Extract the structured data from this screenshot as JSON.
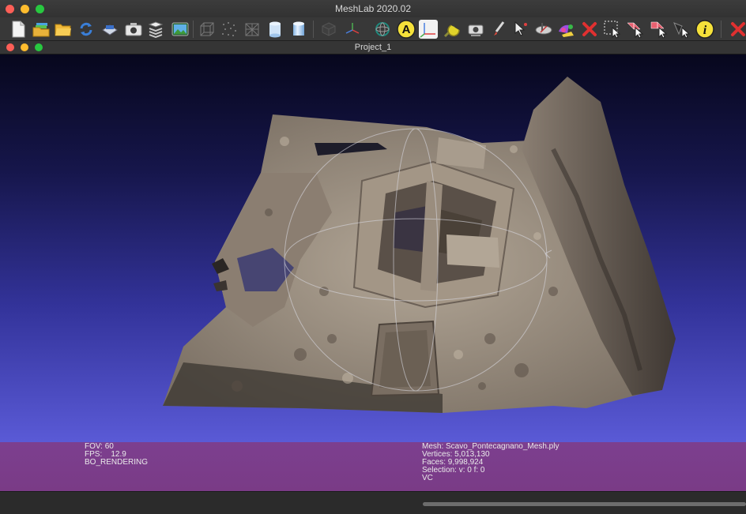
{
  "window": {
    "title": "MeshLab 2020.02"
  },
  "document": {
    "title": "Project_1"
  },
  "toolbar": {
    "buttons": [
      {
        "name": "new-project",
        "icon": "new-document-icon"
      },
      {
        "name": "open-project",
        "icon": "layers-folder-icon"
      },
      {
        "name": "import-mesh",
        "icon": "open-folder-icon"
      },
      {
        "name": "reload",
        "icon": "reload-icon"
      },
      {
        "name": "export-mesh",
        "icon": "save-mesh-icon"
      },
      {
        "name": "snapshot",
        "icon": "camera-icon"
      },
      {
        "name": "layer-dialog",
        "icon": "layers-stack-icon"
      },
      {
        "name": "raster-view",
        "icon": "raster-image-icon"
      },
      {
        "name": "bounding-box",
        "icon": "bbox-icon"
      },
      {
        "name": "points",
        "icon": "points-icon"
      },
      {
        "name": "wireframe",
        "icon": "wireframe-icon"
      },
      {
        "name": "flat",
        "icon": "flat-cylinder-icon"
      },
      {
        "name": "smooth",
        "icon": "smooth-cylinder-icon"
      },
      {
        "name": "texture",
        "icon": "texture-cube-icon"
      },
      {
        "name": "axes",
        "icon": "axes-icon"
      },
      {
        "name": "trackball",
        "icon": "trackball-icon"
      },
      {
        "name": "annotation",
        "icon": "annotation-a-icon",
        "label": "A"
      },
      {
        "name": "measure-axes",
        "icon": "measure-axes-icon",
        "active": true
      },
      {
        "name": "measure-tool",
        "icon": "tape-measure-icon"
      },
      {
        "name": "raster-camera",
        "icon": "raster-camera-icon"
      },
      {
        "name": "paint",
        "icon": "paint-brush-icon"
      },
      {
        "name": "pick-points",
        "icon": "pick-points-icon"
      },
      {
        "name": "align",
        "icon": "align-icon"
      },
      {
        "name": "color-paint",
        "icon": "color-paint-icon"
      },
      {
        "name": "delete-selected",
        "icon": "delete-x-icon"
      },
      {
        "name": "select-faces",
        "icon": "select-faces-icon"
      },
      {
        "name": "select-vertices",
        "icon": "select-vertices-icon"
      },
      {
        "name": "select-connected",
        "icon": "select-connected-icon"
      },
      {
        "name": "select-rect",
        "icon": "select-rect-icon"
      },
      {
        "name": "info",
        "icon": "info-i-icon",
        "label": "i"
      },
      {
        "name": "close-tool",
        "icon": "close-x-icon"
      }
    ]
  },
  "status": {
    "left": [
      "FOV: 60",
      "FPS:    12.9",
      "BO_RENDERING"
    ],
    "right": [
      "Mesh: Scavo_Pontecagnano_Mesh.ply",
      "Vertices: 5,013,130",
      "Faces: 9,998,924",
      "Selection: v: 0 f: 0",
      "VC"
    ]
  },
  "colors": {
    "info_panel": "#7b3e8c",
    "background_top": "#07071d",
    "background_bottom": "#5a5ad6",
    "annotation_yellow": "#f5e13a"
  }
}
